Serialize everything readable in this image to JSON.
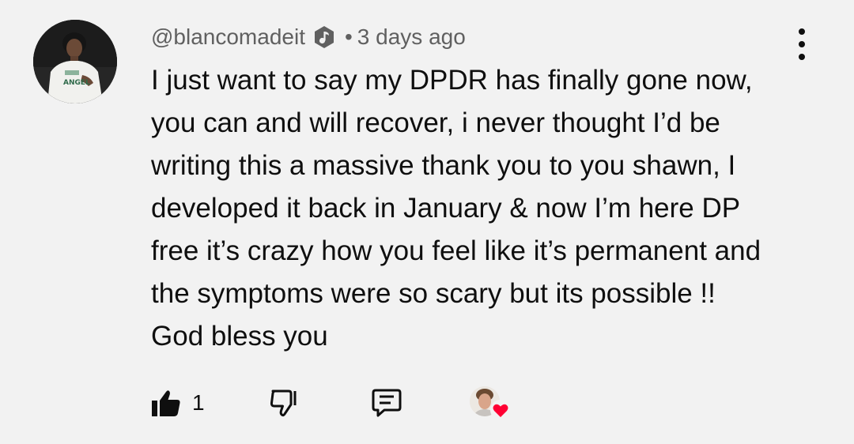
{
  "comment": {
    "author": "@blancomadeit",
    "author_badge_icon": "music-note-badge-icon",
    "separator": "•",
    "timestamp": "3 days ago",
    "text_lines": [
      "I just want to say my DPDR has finally gone now,",
      "you can and will recover, i never thought I’d be",
      "writing this a massive thank you to you shawn, I",
      "developed it back in January & now I’m here DP",
      "free it’s crazy how you feel like it’s permanent and",
      "the symptoms were so scary but its possible !!",
      "God bless you"
    ],
    "like_count": "1"
  },
  "icons": {
    "like": "thumbs-up-icon",
    "dislike": "thumbs-down-icon",
    "reply": "reply-comment-icon",
    "menu": "more-vertical-icon",
    "heart": "creator-heart-icon"
  },
  "colors": {
    "background": "#f2f2f2",
    "text": "#0f0f0f",
    "meta": "#606060",
    "heart": "#ff0033"
  }
}
